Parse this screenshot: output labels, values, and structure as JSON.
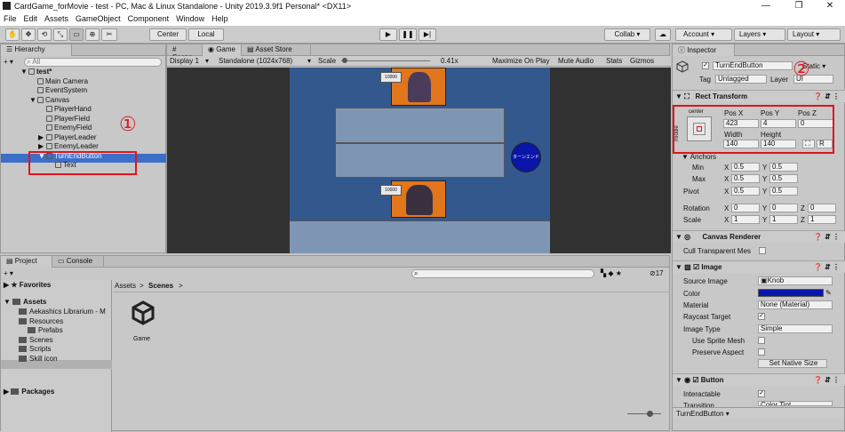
{
  "window": {
    "title": "CardGame_forMovie - test - PC, Mac & Linux Standalone - Unity 2019.3.9f1 Personal* <DX11>",
    "controls": [
      "—",
      "❐",
      "✕"
    ]
  },
  "menu": [
    "File",
    "Edit",
    "Assets",
    "GameObject",
    "Component",
    "Window",
    "Help"
  ],
  "toolbar": {
    "center": "Center",
    "local": "Local",
    "collab": "Collab ▾",
    "account": "Account",
    "layers": "Layers",
    "layout": "Layout"
  },
  "hierarchy": {
    "tab": "Hierarchy",
    "search_placeholder": "All",
    "add": "+ ▾",
    "items": [
      {
        "label": "test*",
        "depth": 0,
        "arrow": "▼"
      },
      {
        "label": "Main Camera",
        "depth": 1,
        "arrow": ""
      },
      {
        "label": "EventSystem",
        "depth": 1,
        "arrow": ""
      },
      {
        "label": "Canvas",
        "depth": 1,
        "arrow": "▼"
      },
      {
        "label": "PlayerHand",
        "depth": 2,
        "arrow": ""
      },
      {
        "label": "PlayerField",
        "depth": 2,
        "arrow": ""
      },
      {
        "label": "EnemyField",
        "depth": 2,
        "arrow": ""
      },
      {
        "label": "PlayerLeader",
        "depth": 2,
        "arrow": "▶"
      },
      {
        "label": "EnemyLeader",
        "depth": 2,
        "arrow": "▶"
      },
      {
        "label": "TurnEndButton",
        "depth": 2,
        "arrow": "▼"
      },
      {
        "label": "Text",
        "depth": 3,
        "arrow": ""
      }
    ]
  },
  "scene": {
    "tabs": [
      "Scene",
      "Game",
      "Asset Store"
    ],
    "display": "Display 1",
    "resolution": "Standalone (1024x768)",
    "scale_label": "Scale",
    "scale_value": "0.41x",
    "options": [
      "Maximize On Play",
      "Mute Audio",
      "Stats",
      "Gizmos"
    ],
    "game": {
      "enemy_hp": "10000",
      "player_hp": "10000",
      "turn_end_label": "ターンエンド"
    }
  },
  "project": {
    "tabs": [
      "Project",
      "Console"
    ],
    "favorites": "Favorites",
    "assets": "Assets",
    "breadcrumb": [
      "Assets",
      "Scenes"
    ],
    "tree": [
      {
        "label": "Aekashics Librarium - M",
        "depth": 1
      },
      {
        "label": "Resources",
        "depth": 1
      },
      {
        "label": "Prefabs",
        "depth": 2
      },
      {
        "label": "Scenes",
        "depth": 1
      },
      {
        "label": "Scripts",
        "depth": 1
      },
      {
        "label": "Skill icon",
        "depth": 1
      }
    ],
    "packages": "Packages",
    "file": "Game",
    "count": "17"
  },
  "inspector": {
    "tab": "Inspector",
    "object_name": "TurnEndButton",
    "static": "Static ▾",
    "tag_label": "Tag",
    "tag": "Untagged",
    "layer_label": "Layer",
    "layer": "UI",
    "rect": {
      "title": "Rect Transform",
      "anchor_h": "center",
      "anchor_v": "middle",
      "pos_x_label": "Pos X",
      "pos_y_label": "Pos Y",
      "pos_z_label": "Pos Z",
      "pos_x": "423",
      "pos_y": "4",
      "pos_z": "0",
      "width_label": "Width",
      "height_label": "Height",
      "width": "140",
      "height": "140",
      "anchors": "Anchors",
      "min": "Min",
      "max": "Max",
      "pivot": "Pivot",
      "min_x": "0.5",
      "min_y": "0.5",
      "max_x": "0.5",
      "max_y": "0.5",
      "pivot_x": "0.5",
      "pivot_y": "0.5",
      "rotation": "Rotation",
      "scale": "Scale",
      "rot_x": "0",
      "rot_y": "0",
      "rot_z": "0",
      "scale_x": "1",
      "scale_y": "1",
      "scale_z": "1",
      "r_btn": "R"
    },
    "canvas_renderer": {
      "title": "Canvas Renderer",
      "cull": "Cull Transparent Mes"
    },
    "image": {
      "title": "Image",
      "source_label": "Source Image",
      "source": "Knob",
      "color_label": "Color",
      "color": "#0a16a8",
      "material_label": "Material",
      "material": "None (Material)",
      "raycast": "Raycast Target",
      "type_label": "Image Type",
      "type": "Simple",
      "use_sprite": "Use Sprite Mesh",
      "preserve": "Preserve Aspect",
      "native": "Set Native Size"
    },
    "button": {
      "title": "Button",
      "interactable": "Interactable",
      "transition_label": "Transition",
      "transition": "Color Tint"
    },
    "footer": "TurnEndButton ▾"
  },
  "annotations": {
    "one": "①",
    "two": "②"
  }
}
